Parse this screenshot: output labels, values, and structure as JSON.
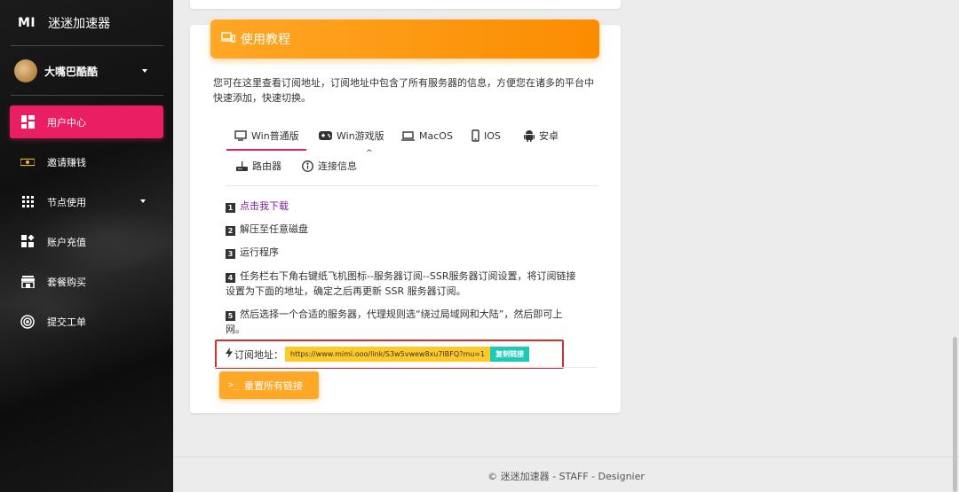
{
  "sidebar": {
    "logo": "MI",
    "app_name": "迷迷加速器",
    "user_name": "大嘴巴酷酷",
    "items": [
      {
        "label": "用户中心",
        "active": true
      },
      {
        "label": "邀请赚钱"
      },
      {
        "label": "节点使用",
        "has_dropdown": true
      },
      {
        "label": "账户充值"
      },
      {
        "label": "套餐购买"
      },
      {
        "label": "提交工单"
      }
    ]
  },
  "card": {
    "title": "使用教程",
    "description": "您可在这里查看订阅地址，订阅地址中包含了所有服务器的信息，方便您在诸多的平台中快速添加，快速切换。",
    "tabs": [
      {
        "label": "Win普通版",
        "icon": "monitor-icon",
        "active": true
      },
      {
        "label": "Win游戏版",
        "icon": "gamepad-icon"
      },
      {
        "label": "MacOS",
        "icon": "laptop-icon"
      },
      {
        "label": "IOS",
        "icon": "phone-icon"
      },
      {
        "label": "安卓",
        "icon": "android-icon"
      },
      {
        "label": "路由器",
        "icon": "router-icon"
      },
      {
        "label": "连接信息",
        "icon": "info-icon"
      }
    ],
    "tab_caret": "^",
    "steps": [
      {
        "num": "1",
        "text": "点击我下载",
        "is_link": true
      },
      {
        "num": "2",
        "text": "解压至任意磁盘"
      },
      {
        "num": "3",
        "text": "运行程序"
      },
      {
        "num": "4",
        "text": "任务栏右下角右键纸飞机图标--服务器订阅--SSR服务器订阅设置，将订阅链接设置为下面的地址，确定之后再更新 SSR 服务器订阅。"
      },
      {
        "num": "5",
        "text": "然后选择一个合适的服务器，代理规则选“绕过局域网和大陆”，然后即可上网。"
      }
    ],
    "subscription_label": "订阅地址：",
    "subscription_url": "https://www.mimi.ooo/link/S3w5vwew8xu7IBFQ?mu=1",
    "copy_label": "复制链接",
    "reset_label": "重置所有链接",
    "reset_icon_text": ">_"
  },
  "footer": "© 迷迷加速器 - STAFF - Designier",
  "colors": {
    "accent": "#e91e63",
    "orange": "#ffa726",
    "teal": "#1dc9b7",
    "highlight_border": "#d32f2f"
  }
}
